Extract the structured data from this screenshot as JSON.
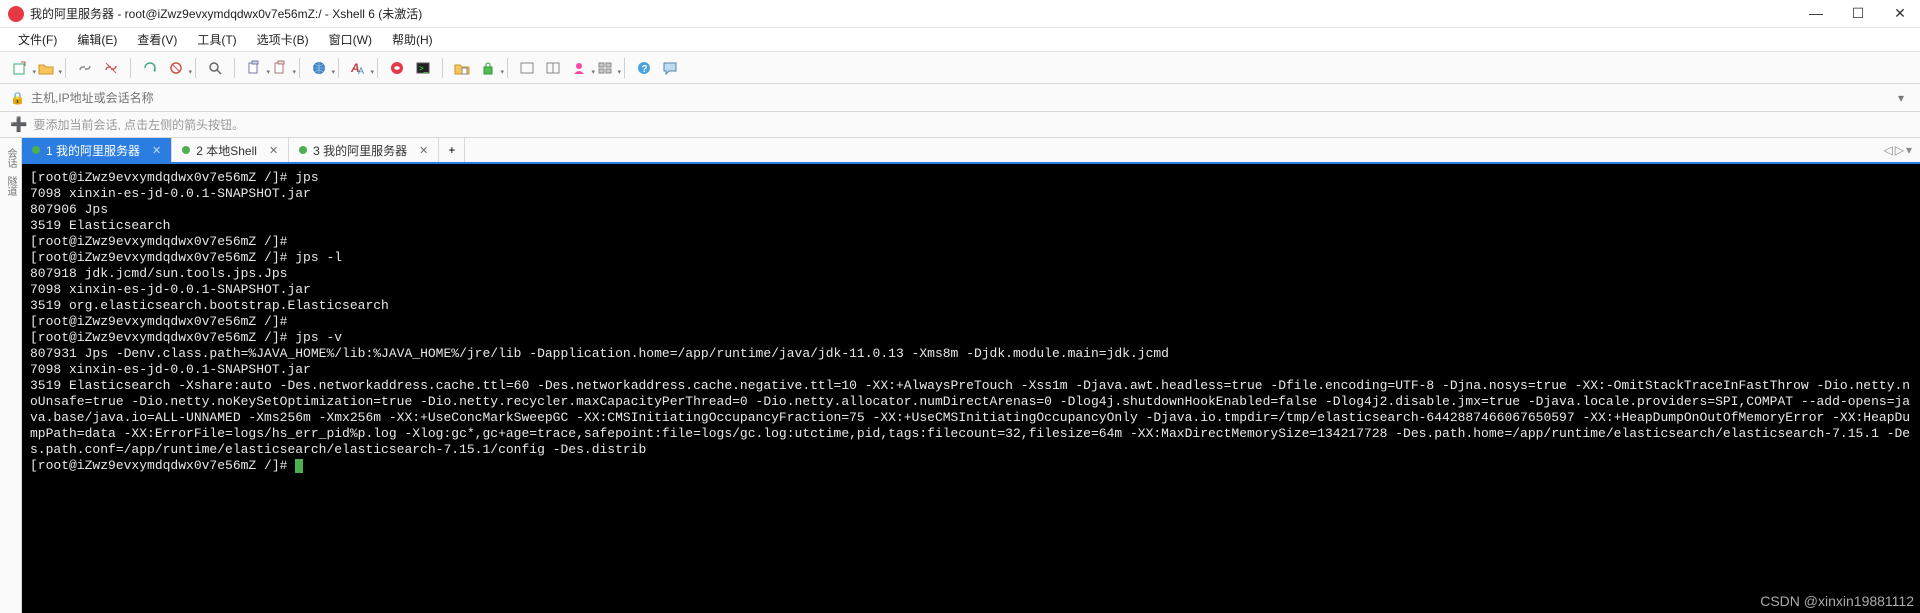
{
  "window": {
    "title": "我的阿里服务器 - root@iZwz9evxymdqdwx0v7e56mZ:/ - Xshell 6 (未激活)"
  },
  "menu": {
    "file": "文件(F)",
    "edit": "编辑(E)",
    "view": "查看(V)",
    "tools": "工具(T)",
    "tabs": "选项卡(B)",
    "window": "窗口(W)",
    "help": "帮助(H)"
  },
  "address": {
    "placeholder": "主机,IP地址或会话名称"
  },
  "hint": {
    "text": "要添加当前会话, 点击左侧的箭头按钮。"
  },
  "leftrail": {
    "sessions": "会话",
    "tunnel": "隧道"
  },
  "tabs": {
    "items": [
      {
        "label": "1 我的阿里服务器",
        "active": true
      },
      {
        "label": "2 本地Shell",
        "active": false
      },
      {
        "label": "3 我的阿里服务器",
        "active": false
      }
    ],
    "add": "+"
  },
  "nav": {
    "left": "◁",
    "right": "▷",
    "menu": "▾"
  },
  "terminal": {
    "lines": [
      "[root@iZwz9evxymdqdwx0v7e56mZ /]# jps",
      "7098 xinxin-es-jd-0.0.1-SNAPSHOT.jar",
      "807906 Jps",
      "3519 Elasticsearch",
      "[root@iZwz9evxymdqdwx0v7e56mZ /]#",
      "[root@iZwz9evxymdqdwx0v7e56mZ /]# jps -l",
      "807918 jdk.jcmd/sun.tools.jps.Jps",
      "7098 xinxin-es-jd-0.0.1-SNAPSHOT.jar",
      "3519 org.elasticsearch.bootstrap.Elasticsearch",
      "[root@iZwz9evxymdqdwx0v7e56mZ /]#",
      "[root@iZwz9evxymdqdwx0v7e56mZ /]# jps -v",
      "807931 Jps -Denv.class.path=%JAVA_HOME%/lib:%JAVA_HOME%/jre/lib -Dapplication.home=/app/runtime/java/jdk-11.0.13 -Xms8m -Djdk.module.main=jdk.jcmd",
      "7098 xinxin-es-jd-0.0.1-SNAPSHOT.jar",
      "3519 Elasticsearch -Xshare:auto -Des.networkaddress.cache.ttl=60 -Des.networkaddress.cache.negative.ttl=10 -XX:+AlwaysPreTouch -Xss1m -Djava.awt.headless=true -Dfile.encoding=UTF-8 -Djna.nosys=true -XX:-OmitStackTraceInFastThrow -Dio.netty.noUnsafe=true -Dio.netty.noKeySetOptimization=true -Dio.netty.recycler.maxCapacityPerThread=0 -Dio.netty.allocator.numDirectArenas=0 -Dlog4j.shutdownHookEnabled=false -Dlog4j2.disable.jmx=true -Djava.locale.providers=SPI,COMPAT --add-opens=java.base/java.io=ALL-UNNAMED -Xms256m -Xmx256m -XX:+UseConcMarkSweepGC -XX:CMSInitiatingOccupancyFraction=75 -XX:+UseCMSInitiatingOccupancyOnly -Djava.io.tmpdir=/tmp/elasticsearch-6442887466067650597 -XX:+HeapDumpOnOutOfMemoryError -XX:HeapDumpPath=data -XX:ErrorFile=logs/hs_err_pid%p.log -Xlog:gc*,gc+age=trace,safepoint:file=logs/gc.log:utctime,pid,tags:filecount=32,filesize=64m -XX:MaxDirectMemorySize=134217728 -Des.path.home=/app/runtime/elasticsearch/elasticsearch-7.15.1 -Des.path.conf=/app/runtime/elasticsearch/elasticsearch-7.15.1/config -Des.distrib",
      "[root@iZwz9evxymdqdwx0v7e56mZ /]# "
    ]
  },
  "watermark": "CSDN @xinxin19881112",
  "colors": {
    "tab_active_bg": "#2b7de1",
    "status_dot": "#4caf50",
    "cursor": "#4caf50"
  }
}
